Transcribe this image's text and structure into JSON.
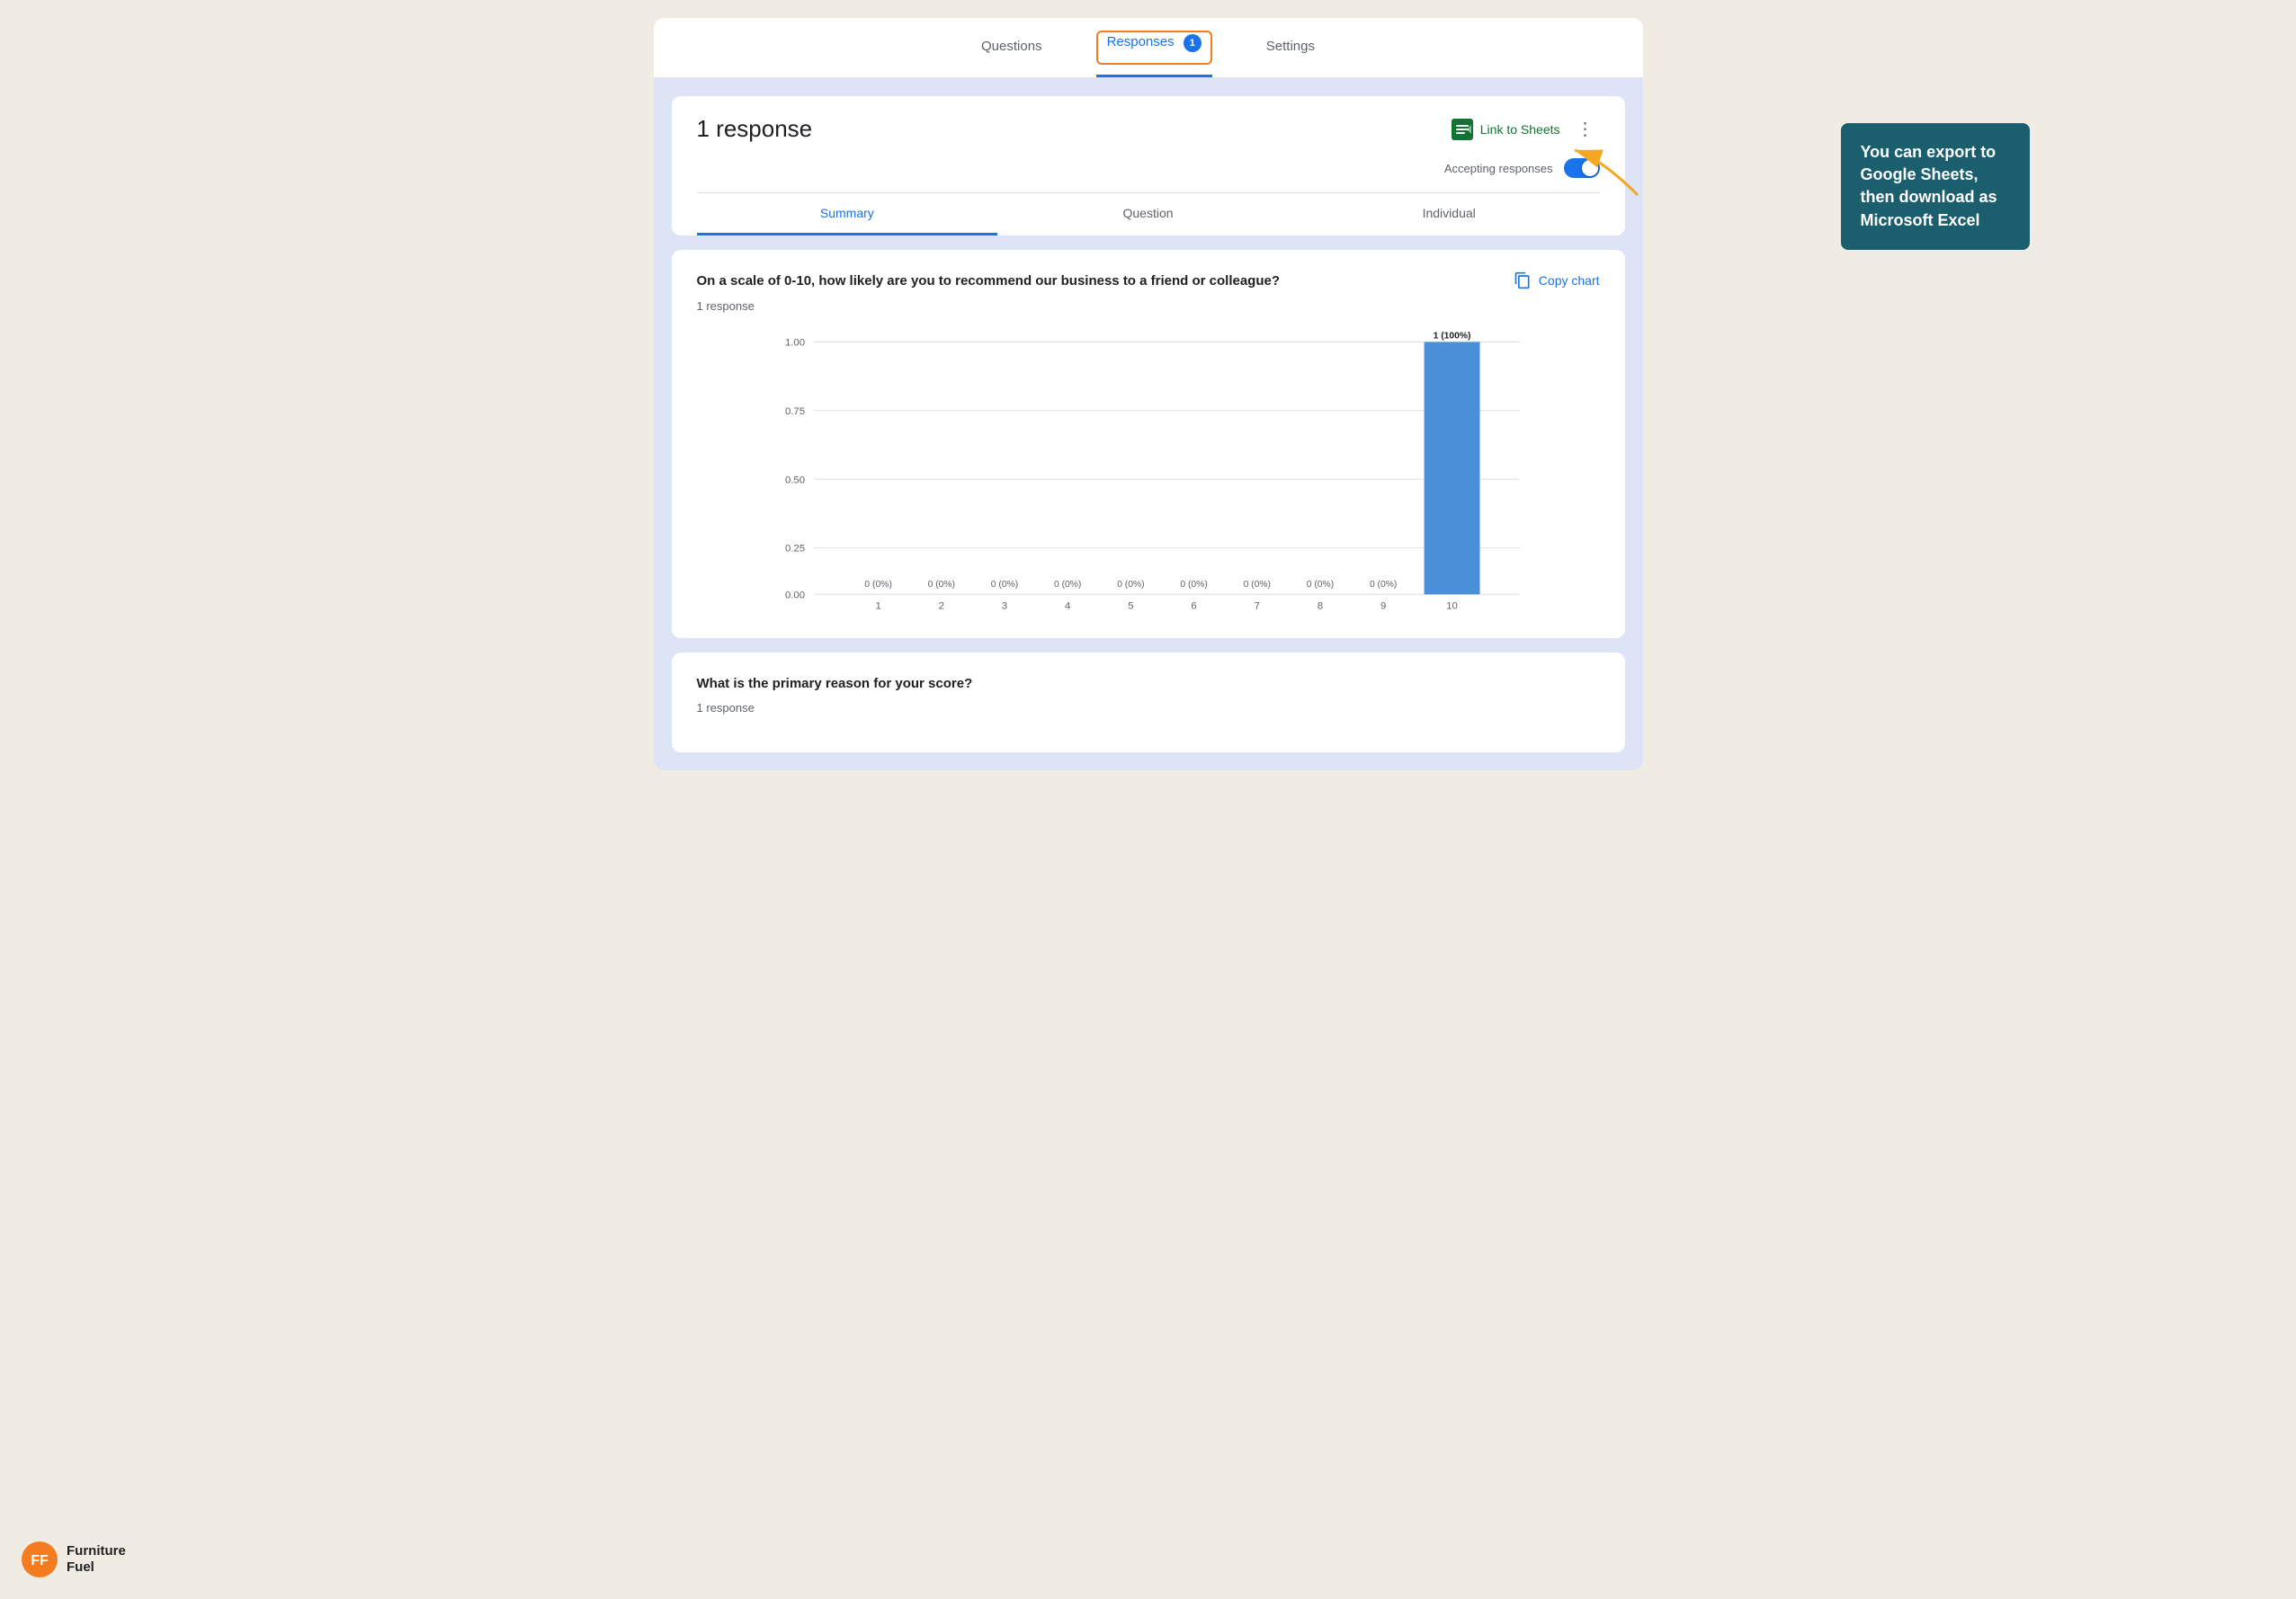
{
  "tabs": {
    "items": [
      {
        "label": "Questions",
        "active": false
      },
      {
        "label": "Responses",
        "active": true,
        "badge": "1"
      },
      {
        "label": "Settings",
        "active": false
      }
    ]
  },
  "response_header": {
    "count_text": "1 response",
    "link_to_sheets_label": "Link to Sheets",
    "accepting_label": "Accepting responses"
  },
  "sub_tabs": {
    "items": [
      {
        "label": "Summary",
        "active": true
      },
      {
        "label": "Question",
        "active": false
      },
      {
        "label": "Individual",
        "active": false
      }
    ]
  },
  "question1": {
    "text": "On a scale of 0-10, how likely are you to recommend our business to a friend or colleague?",
    "response_count": "1 response",
    "copy_chart_label": "Copy chart",
    "chart": {
      "bars": [
        {
          "x_label": "1",
          "value": 0,
          "label": "0 (0%)"
        },
        {
          "x_label": "2",
          "value": 0,
          "label": "0 (0%)"
        },
        {
          "x_label": "3",
          "value": 0,
          "label": "0 (0%)"
        },
        {
          "x_label": "4",
          "value": 0,
          "label": "0 (0%)"
        },
        {
          "x_label": "5",
          "value": 0,
          "label": "0 (0%)"
        },
        {
          "x_label": "6",
          "value": 0,
          "label": "0 (0%)"
        },
        {
          "x_label": "7",
          "value": 0,
          "label": "0 (0%)"
        },
        {
          "x_label": "8",
          "value": 0,
          "label": "0 (0%)"
        },
        {
          "x_label": "9",
          "value": 0,
          "label": "0 (0%)"
        },
        {
          "x_label": "10",
          "value": 1,
          "label": "1 (100%)"
        }
      ],
      "y_labels": [
        "0.00",
        "0.25",
        "0.50",
        "0.75",
        "1.00"
      ]
    }
  },
  "question2": {
    "text": "What is the primary reason for your score?",
    "response_count": "1 response"
  },
  "annotation": {
    "text": "You can export to Google Sheets, then download as Microsoft Excel"
  },
  "logo": {
    "name": "Furniture Fuel"
  }
}
